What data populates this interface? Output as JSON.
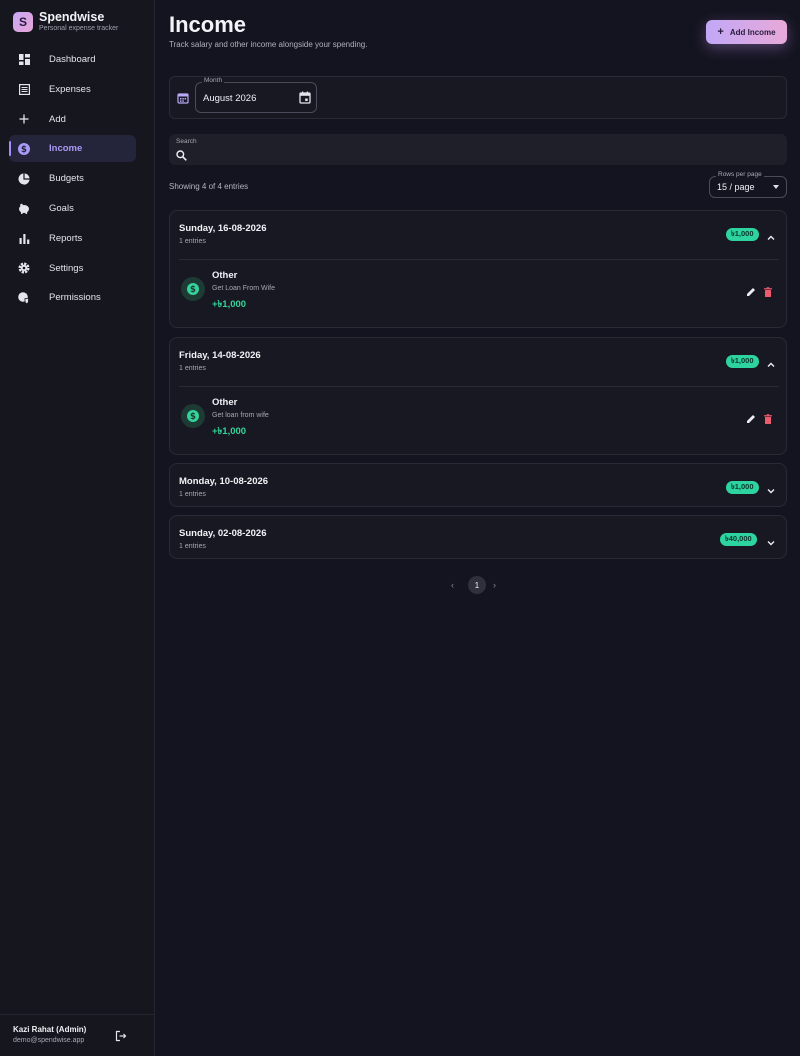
{
  "app": {
    "name": "Spendwise",
    "tagline": "Personal expense tracker",
    "logo_letter": "S"
  },
  "sidebar": {
    "items": [
      {
        "label": "Dashboard",
        "icon": "dashboard-icon"
      },
      {
        "label": "Expenses",
        "icon": "list-icon"
      },
      {
        "label": "Add",
        "icon": "plus-icon"
      },
      {
        "label": "Income",
        "icon": "dollar-circle-icon",
        "active": true
      },
      {
        "label": "Budgets",
        "icon": "pie-chart-icon"
      },
      {
        "label": "Goals",
        "icon": "piggy-bank-icon"
      },
      {
        "label": "Reports",
        "icon": "bar-chart-icon"
      },
      {
        "label": "Settings",
        "icon": "gear-icon"
      },
      {
        "label": "Permissions",
        "icon": "user-shield-icon"
      }
    ],
    "user": {
      "name": "Kazi Rahat (Admin)",
      "email": "demo@spendwise.app"
    }
  },
  "header": {
    "title": "Income",
    "subtitle": "Track salary and other income alongside your spending.",
    "add_button": "Add Income"
  },
  "filters": {
    "month_label": "Month",
    "month_value": "August 2026",
    "search_label": "Search",
    "showing_text": "Showing 4 of 4 entries",
    "rows_label": "Rows per page",
    "rows_value": "15 / page"
  },
  "groups": [
    {
      "date": "Sunday, 16-08-2026",
      "count": "1 entries",
      "total": "৳1,000",
      "expanded": true,
      "entry": {
        "category": "Other",
        "note": "Get Loan From Wife",
        "amount": "+৳1,000"
      }
    },
    {
      "date": "Friday, 14-08-2026",
      "count": "1 entries",
      "total": "৳1,000",
      "expanded": true,
      "entry": {
        "category": "Other",
        "note": "Get loan from wife",
        "amount": "+৳1,000"
      }
    },
    {
      "date": "Monday, 10-08-2026",
      "count": "1 entries",
      "total": "৳1,000",
      "expanded": false
    },
    {
      "date": "Sunday, 02-08-2026",
      "count": "1 entries",
      "total": "৳40,000",
      "expanded": false
    }
  ],
  "pagination": {
    "current": "1",
    "prev": "‹",
    "next": "›"
  },
  "colors": {
    "accent": "#a78bfa",
    "income_green": "#34d399",
    "badge_green": "#2dd4a0",
    "delete_red": "#f05a6e"
  }
}
